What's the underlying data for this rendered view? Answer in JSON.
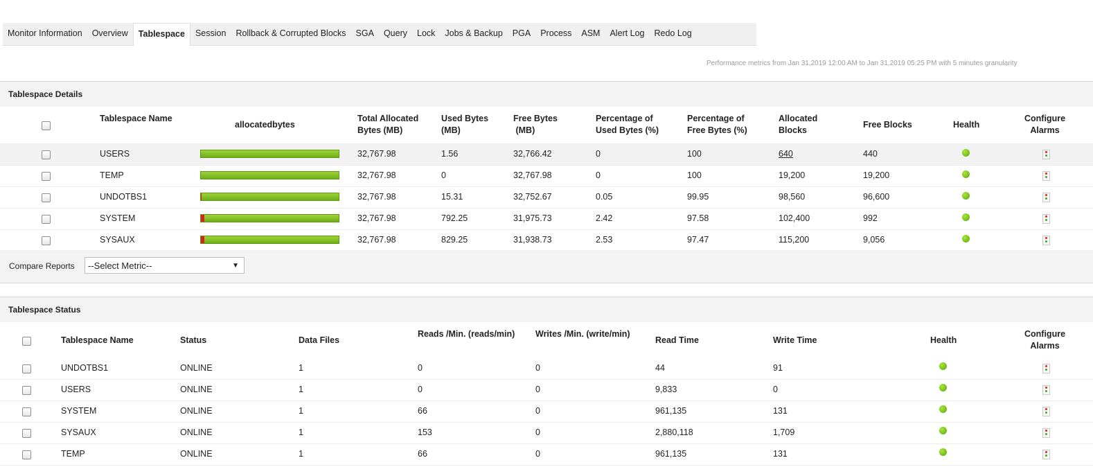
{
  "tabs": [
    "Monitor Information",
    "Overview",
    "Tablespace",
    "Session",
    "Rollback & Corrupted Blocks",
    "SGA",
    "Query",
    "Lock",
    "Jobs & Backup",
    "PGA",
    "Process",
    "ASM",
    "Alert Log",
    "Redo Log"
  ],
  "active_tab": "Tablespace",
  "perf_note": "Performance metrics from Jan 31,2019 12:00 AM to Jan 31,2019 05:25 PM with 5 minutes granularity",
  "details": {
    "title": "Tablespace Details",
    "headers": {
      "name": "Tablespace Name",
      "allocated": "allocatedbytes",
      "total_1": "Total Allocated",
      "total_2": "Bytes  (MB)",
      "used_1": "Used Bytes",
      "used_2": "(MB)",
      "free_1": "Free Bytes",
      "free_2": " (MB)",
      "pused_1": "Percentage of",
      "pused_2": "Used Bytes  (%)",
      "pfree_1": "Percentage of",
      "pfree_2": "Free Bytes  (%)",
      "ablocks_1": "Allocated",
      "ablocks_2": "Blocks",
      "fblocks": "Free Blocks",
      "health": "Health",
      "alarms_1": "Configure",
      "alarms_2": "Alarms"
    },
    "rows": [
      {
        "name": "USERS",
        "total": "32,767.98",
        "used": "1.56",
        "free": "32,766.42",
        "pused": "0",
        "pfree": "100",
        "ablocks": "640",
        "fblocks": "440",
        "used_fraction": 0.0
      },
      {
        "name": "TEMP",
        "total": "32,767.98",
        "used": "0",
        "free": "32,767.98",
        "pused": "0",
        "pfree": "100",
        "ablocks": "19,200",
        "fblocks": "19,200",
        "used_fraction": 0.0
      },
      {
        "name": "UNDOTBS1",
        "total": "32,767.98",
        "used": "15.31",
        "free": "32,752.67",
        "pused": "0.05",
        "pfree": "99.95",
        "ablocks": "98,560",
        "fblocks": "96,600",
        "used_fraction": 0.0005
      },
      {
        "name": "SYSTEM",
        "total": "32,767.98",
        "used": "792.25",
        "free": "31,975.73",
        "pused": "2.42",
        "pfree": "97.58",
        "ablocks": "102,400",
        "fblocks": "992",
        "used_fraction": 0.0242
      },
      {
        "name": "SYSAUX",
        "total": "32,767.98",
        "used": "829.25",
        "free": "31,938.73",
        "pused": "2.53",
        "pfree": "97.47",
        "ablocks": "115,200",
        "fblocks": "9,056",
        "used_fraction": 0.0253
      }
    ],
    "compare_label": "Compare Reports",
    "compare_value": "--Select Metric--"
  },
  "status": {
    "title": "Tablespace Status",
    "headers": {
      "name": "Tablespace Name",
      "status": "Status",
      "files": "Data Files",
      "reads": "Reads /Min.  (reads/min)",
      "writes": "Writes /Min.  (write/min)",
      "rtime": "Read Time",
      "wtime": "Write Time",
      "health": "Health",
      "alarms_1": "Configure",
      "alarms_2": "Alarms"
    },
    "rows": [
      {
        "name": "UNDOTBS1",
        "status": "ONLINE",
        "files": "1",
        "reads": "0",
        "writes": "0",
        "rtime": "44",
        "wtime": "91"
      },
      {
        "name": "USERS",
        "status": "ONLINE",
        "files": "1",
        "reads": "0",
        "writes": "0",
        "rtime": "9,833",
        "wtime": "0"
      },
      {
        "name": "SYSTEM",
        "status": "ONLINE",
        "files": "1",
        "reads": "66",
        "writes": "0",
        "rtime": "961,135",
        "wtime": "131"
      },
      {
        "name": "SYSAUX",
        "status": "ONLINE",
        "files": "1",
        "reads": "153",
        "writes": "0",
        "rtime": "2,880,118",
        "wtime": "1,709"
      },
      {
        "name": "TEMP",
        "status": "ONLINE",
        "files": "1",
        "reads": "66",
        "writes": "0",
        "rtime": "961,135",
        "wtime": "131"
      }
    ]
  },
  "colors": {
    "health_ok": "#6cbf1a",
    "bar_free": "#7fbf1f",
    "bar_used": "#d82020"
  },
  "icons": {
    "health": "health-ok-icon",
    "alarm": "configure-alarm-icon",
    "dropdown": "chevron-down-icon"
  }
}
